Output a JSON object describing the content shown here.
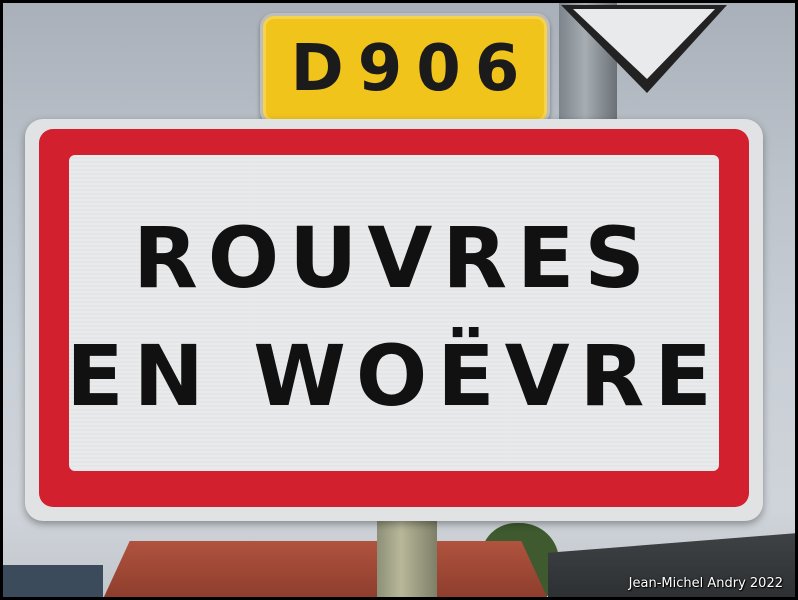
{
  "road_number": "D906",
  "sign": {
    "line1": "ROUVRES",
    "line2": "EN WOËVRE"
  },
  "credit": "Jean-Michel Andry 2022",
  "colors": {
    "road_plate": "#f1c41c",
    "sign_border": "#d2202f",
    "sign_background": "#e9eaec",
    "sign_text": "#111111"
  }
}
